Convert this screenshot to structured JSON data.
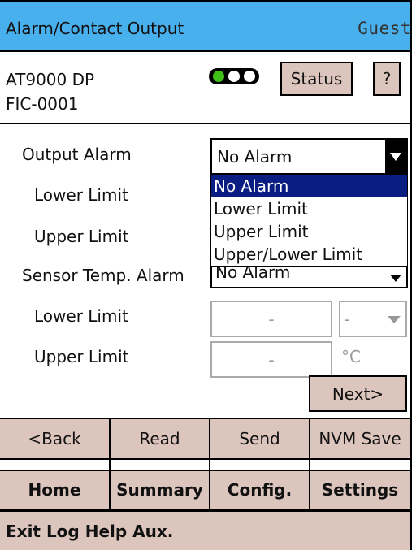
{
  "titlebar": {
    "title": "Alarm/Contact Output",
    "user": "Guest"
  },
  "device": {
    "model": "AT9000 DP",
    "tag": "FIC-0001"
  },
  "header_buttons": {
    "status": "Status",
    "help": "?"
  },
  "form": {
    "output_alarm_label": "Output Alarm",
    "output_alarm_value": "No Alarm",
    "output_alarm_options": [
      "No Alarm",
      "Lower Limit",
      "Upper Limit",
      "Upper/Lower Limit"
    ],
    "lower_limit_label": "Lower Limit",
    "upper_limit_label": "Upper Limit",
    "sensor_alarm_label": "Sensor Temp. Alarm",
    "sensor_alarm_value": "No Alarm",
    "sensor_lower_label": "Lower Limit",
    "sensor_lower_value": "-",
    "sensor_lower_unit": "-",
    "sensor_upper_label": "Upper Limit",
    "sensor_upper_value": "-",
    "sensor_upper_unit": "°C",
    "next": "Next>"
  },
  "action_bar": [
    "<Back",
    "Read",
    "Send",
    "NVM Save"
  ],
  "nav_bar": [
    "Home",
    "Summary",
    "Config.",
    "Settings"
  ],
  "footer": "Exit Log Help Aux.",
  "colors": {
    "titlebar": "#49b0ee",
    "button": "#dcc5bd",
    "selection": "#0a1d82",
    "led_green": "#3ec016"
  }
}
